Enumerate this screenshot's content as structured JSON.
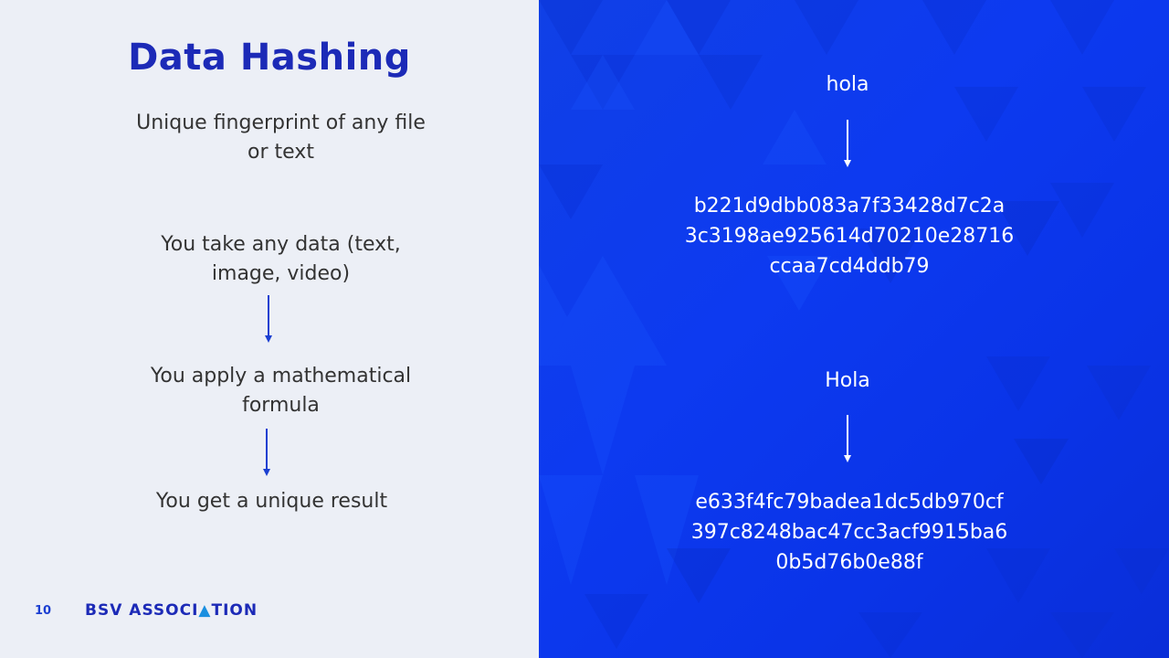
{
  "slide": {
    "title": "Data Hashing",
    "subtitle_line1": "Unique fingerprint of any file",
    "subtitle_line2": "or text",
    "step1_line1": "You take any data (text,",
    "step1_line2": "image, video)",
    "step2_line1": "You apply a mathematical",
    "step2_line2": "formula",
    "step3": "You get a unique result",
    "page_number": "10",
    "logo_text_bsv": "BSV",
    "logo_text_assoc_pre": "ASSOCI",
    "logo_text_assoc_tri": "▲",
    "logo_text_assoc_post": "TION"
  },
  "examples": [
    {
      "input": "hola",
      "hash_line1": "b221d9dbb083a7f33428d7c2a",
      "hash_line2": "3c3198ae925614d70210e28716",
      "hash_line3": "ccaa7cd4ddb79"
    },
    {
      "input": "Hola",
      "hash_line1": "e633f4fc79badea1dc5db970cf",
      "hash_line2": "397c8248bac47cc3acf9915ba6",
      "hash_line3": "0b5d76b0e88f"
    }
  ],
  "colors": {
    "title": "#1c2ab7",
    "left_bg": "#eceff6",
    "right_bg": "#0d3af0",
    "arrow": "#1a3fd1"
  }
}
